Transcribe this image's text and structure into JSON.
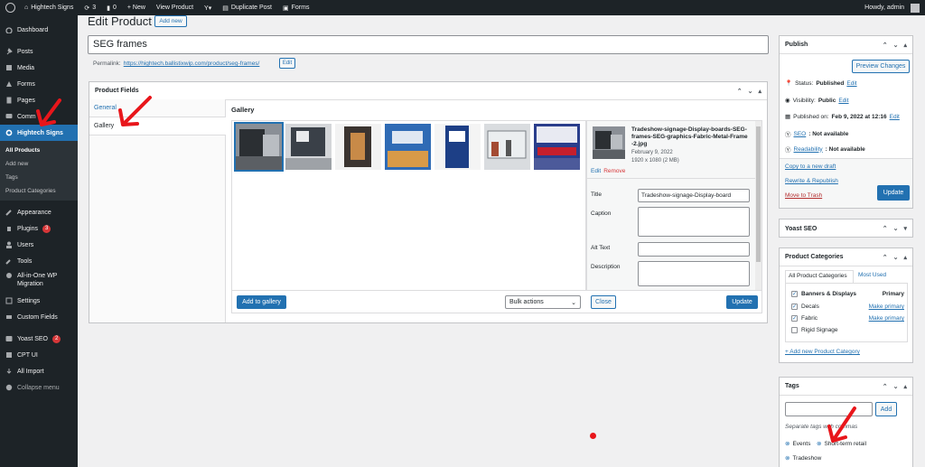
{
  "adminbar": {
    "site_name": "Hightech Signs",
    "updates_count": "3",
    "comments_count": "0",
    "new_label": "+ New",
    "view_product": "View Product",
    "duplicate_post": "Duplicate Post",
    "forms": "Forms",
    "howdy": "Howdy, admin"
  },
  "sidebar": {
    "items": [
      {
        "label": "Dashboard",
        "icon": "dashboard-icon"
      },
      {
        "label": "Posts",
        "icon": "pin-icon"
      },
      {
        "label": "Media",
        "icon": "media-icon"
      },
      {
        "label": "Forms",
        "icon": "forms-icon"
      },
      {
        "label": "Pages",
        "icon": "pages-icon"
      },
      {
        "label": "Comm",
        "icon": "comments-icon"
      },
      {
        "label": "Hightech Signs",
        "icon": "gear-icon"
      }
    ],
    "submenu": [
      "All Products",
      "Add new",
      "Tags",
      "Product Categories"
    ],
    "items2": [
      {
        "label": "Appearance",
        "icon": "brush-icon"
      },
      {
        "label": "Plugins",
        "icon": "plugin-icon",
        "badge": "3"
      },
      {
        "label": "Users",
        "icon": "users-icon"
      },
      {
        "label": "Tools",
        "icon": "wrench-icon"
      },
      {
        "label": "All-in-One WP Migration",
        "icon": "migration-icon"
      },
      {
        "label": "Settings",
        "icon": "settings-icon"
      },
      {
        "label": "Custom Fields",
        "icon": "fields-icon"
      },
      {
        "label": "Yoast SEO",
        "icon": "yoast-icon",
        "badge": "2"
      },
      {
        "label": "CPT UI",
        "icon": "cpt-icon"
      },
      {
        "label": "All Import",
        "icon": "import-icon"
      },
      {
        "label": "Collapse menu",
        "icon": "collapse-icon"
      }
    ]
  },
  "main": {
    "heading": "Edit Product",
    "add_new": "Add new",
    "title_value": "SEG frames",
    "permalink_label": "Permalink:",
    "permalink_url": "https://hightech.ballistixwip.com/product/seg-frames/",
    "permalink_edit": "Edit"
  },
  "product_fields": {
    "title": "Product Fields",
    "tabs": [
      "General",
      "Gallery"
    ],
    "gallery_heading": "Gallery",
    "add_to_gallery": "Add to gallery",
    "bulk_actions": "Bulk actions",
    "detail": {
      "filename": "Tradeshow-signage-Display-boards-SEG-frames-SEG-graphics-Fabric-Metal-Frame-2.jpg",
      "date": "February 9, 2022",
      "dims": "1920 x 1080 (2 MB)",
      "edit": "Edit",
      "remove": "Remove",
      "title_label": "Title",
      "title_value": "Tradeshow-signage-Display-board",
      "caption_label": "Caption",
      "alt_label": "Alt Text",
      "description_label": "Description",
      "close": "Close",
      "update": "Update"
    }
  },
  "publish": {
    "title": "Publish",
    "preview": "Preview Changes",
    "status_label": "Status:",
    "status_value": "Published",
    "visibility_label": "Visibility:",
    "visibility_value": "Public",
    "published_on_label": "Published on:",
    "published_on_value": "Feb 9, 2022 at 12:16",
    "seo_label": "SEO",
    "seo_value": ": Not available",
    "readability_label": "Readability",
    "readability_value": ": Not available",
    "edit": "Edit",
    "copy_draft": "Copy to a new draft",
    "rewrite": "Rewrite & Republish",
    "trash": "Move to Trash",
    "update": "Update"
  },
  "yoast": {
    "title": "Yoast SEO"
  },
  "categories": {
    "title": "Product Categories",
    "tab_all": "All Product Categories",
    "tab_most": "Most Used",
    "items": [
      {
        "label": "Banners & Displays",
        "checked": true,
        "tag": "Primary"
      },
      {
        "label": "Decals",
        "checked": true,
        "tag": "Make primary"
      },
      {
        "label": "Fabric",
        "checked": true,
        "tag": "Make primary"
      },
      {
        "label": "Rigid Signage",
        "checked": false,
        "tag": ""
      }
    ],
    "add_new": "+ Add new Product Category"
  },
  "tags": {
    "title": "Tags",
    "add": "Add",
    "hint": "Separate tags with commas",
    "items": [
      "Events",
      "Short-term retail",
      "Tradeshow"
    ]
  },
  "colors": {
    "accent": "#2271b1",
    "admin_dark": "#1d2327",
    "annotation_red": "#e8161b"
  }
}
